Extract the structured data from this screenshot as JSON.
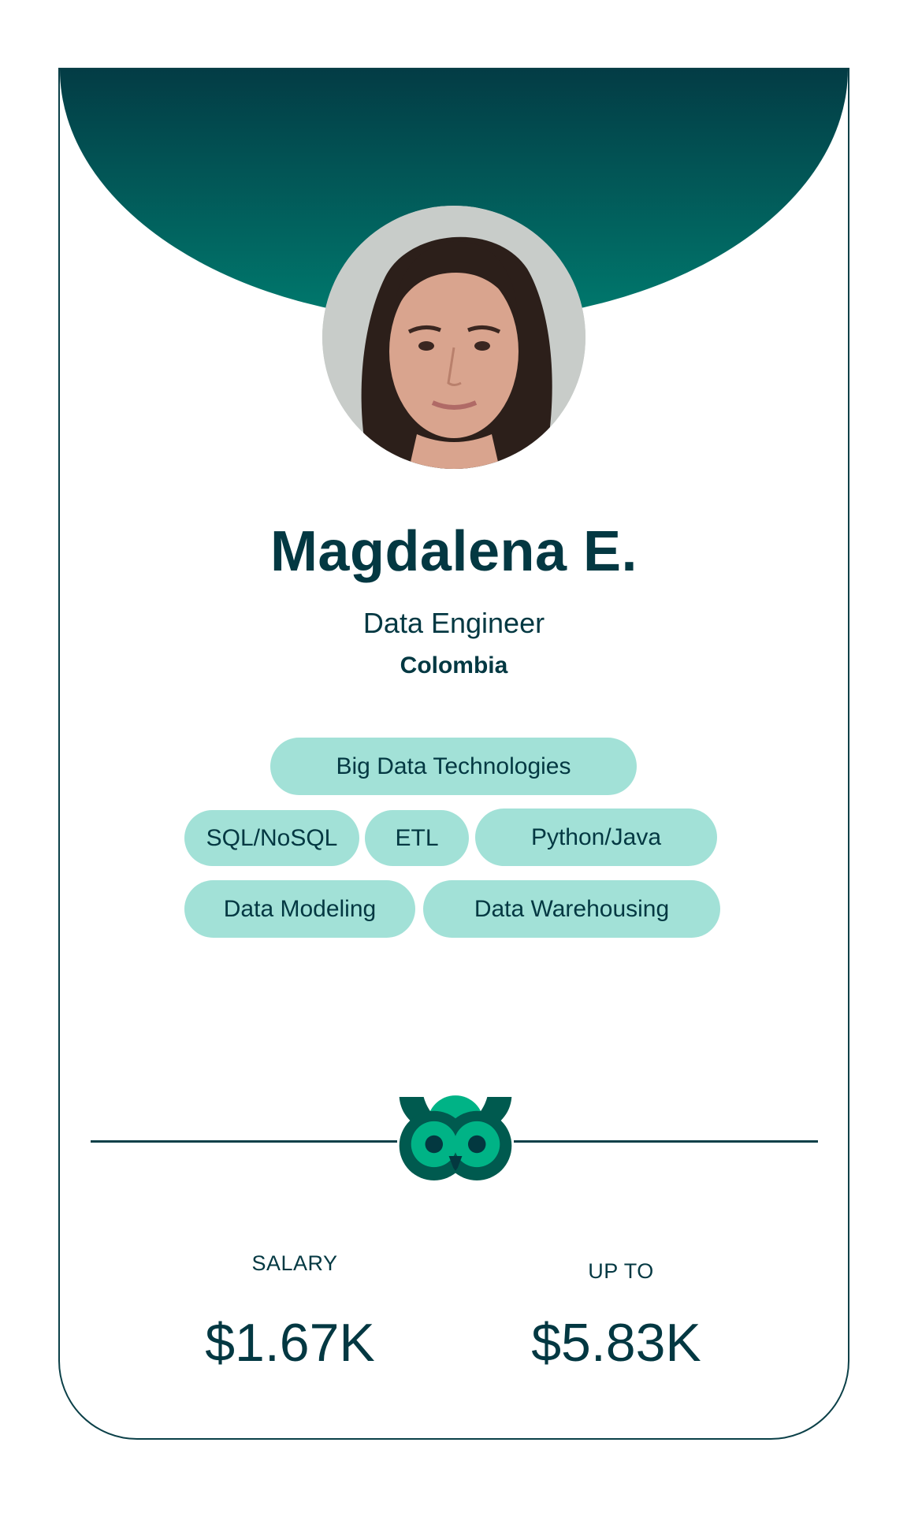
{
  "profile": {
    "name": "Magdalena E.",
    "role": "Data Engineer",
    "country": "Colombia",
    "avatar": "profile-photo"
  },
  "skills": [
    "Big Data Technologies",
    "SQL/NoSQL",
    "ETL",
    "Python/Java",
    "Data Modeling",
    "Data Warehousing"
  ],
  "logo": "owl-icon",
  "salary": {
    "label": "SALARY",
    "value": "$1.67K",
    "max_label": "UP TO",
    "max_value": "$5.83K"
  },
  "colors": {
    "header_top": "#033c45",
    "header_bottom": "#007a6e",
    "text": "#033842",
    "pill": "#a2e1d7",
    "owl_dark": "#005a4f",
    "owl_green": "#00b386",
    "owl_pupil": "#033840"
  }
}
